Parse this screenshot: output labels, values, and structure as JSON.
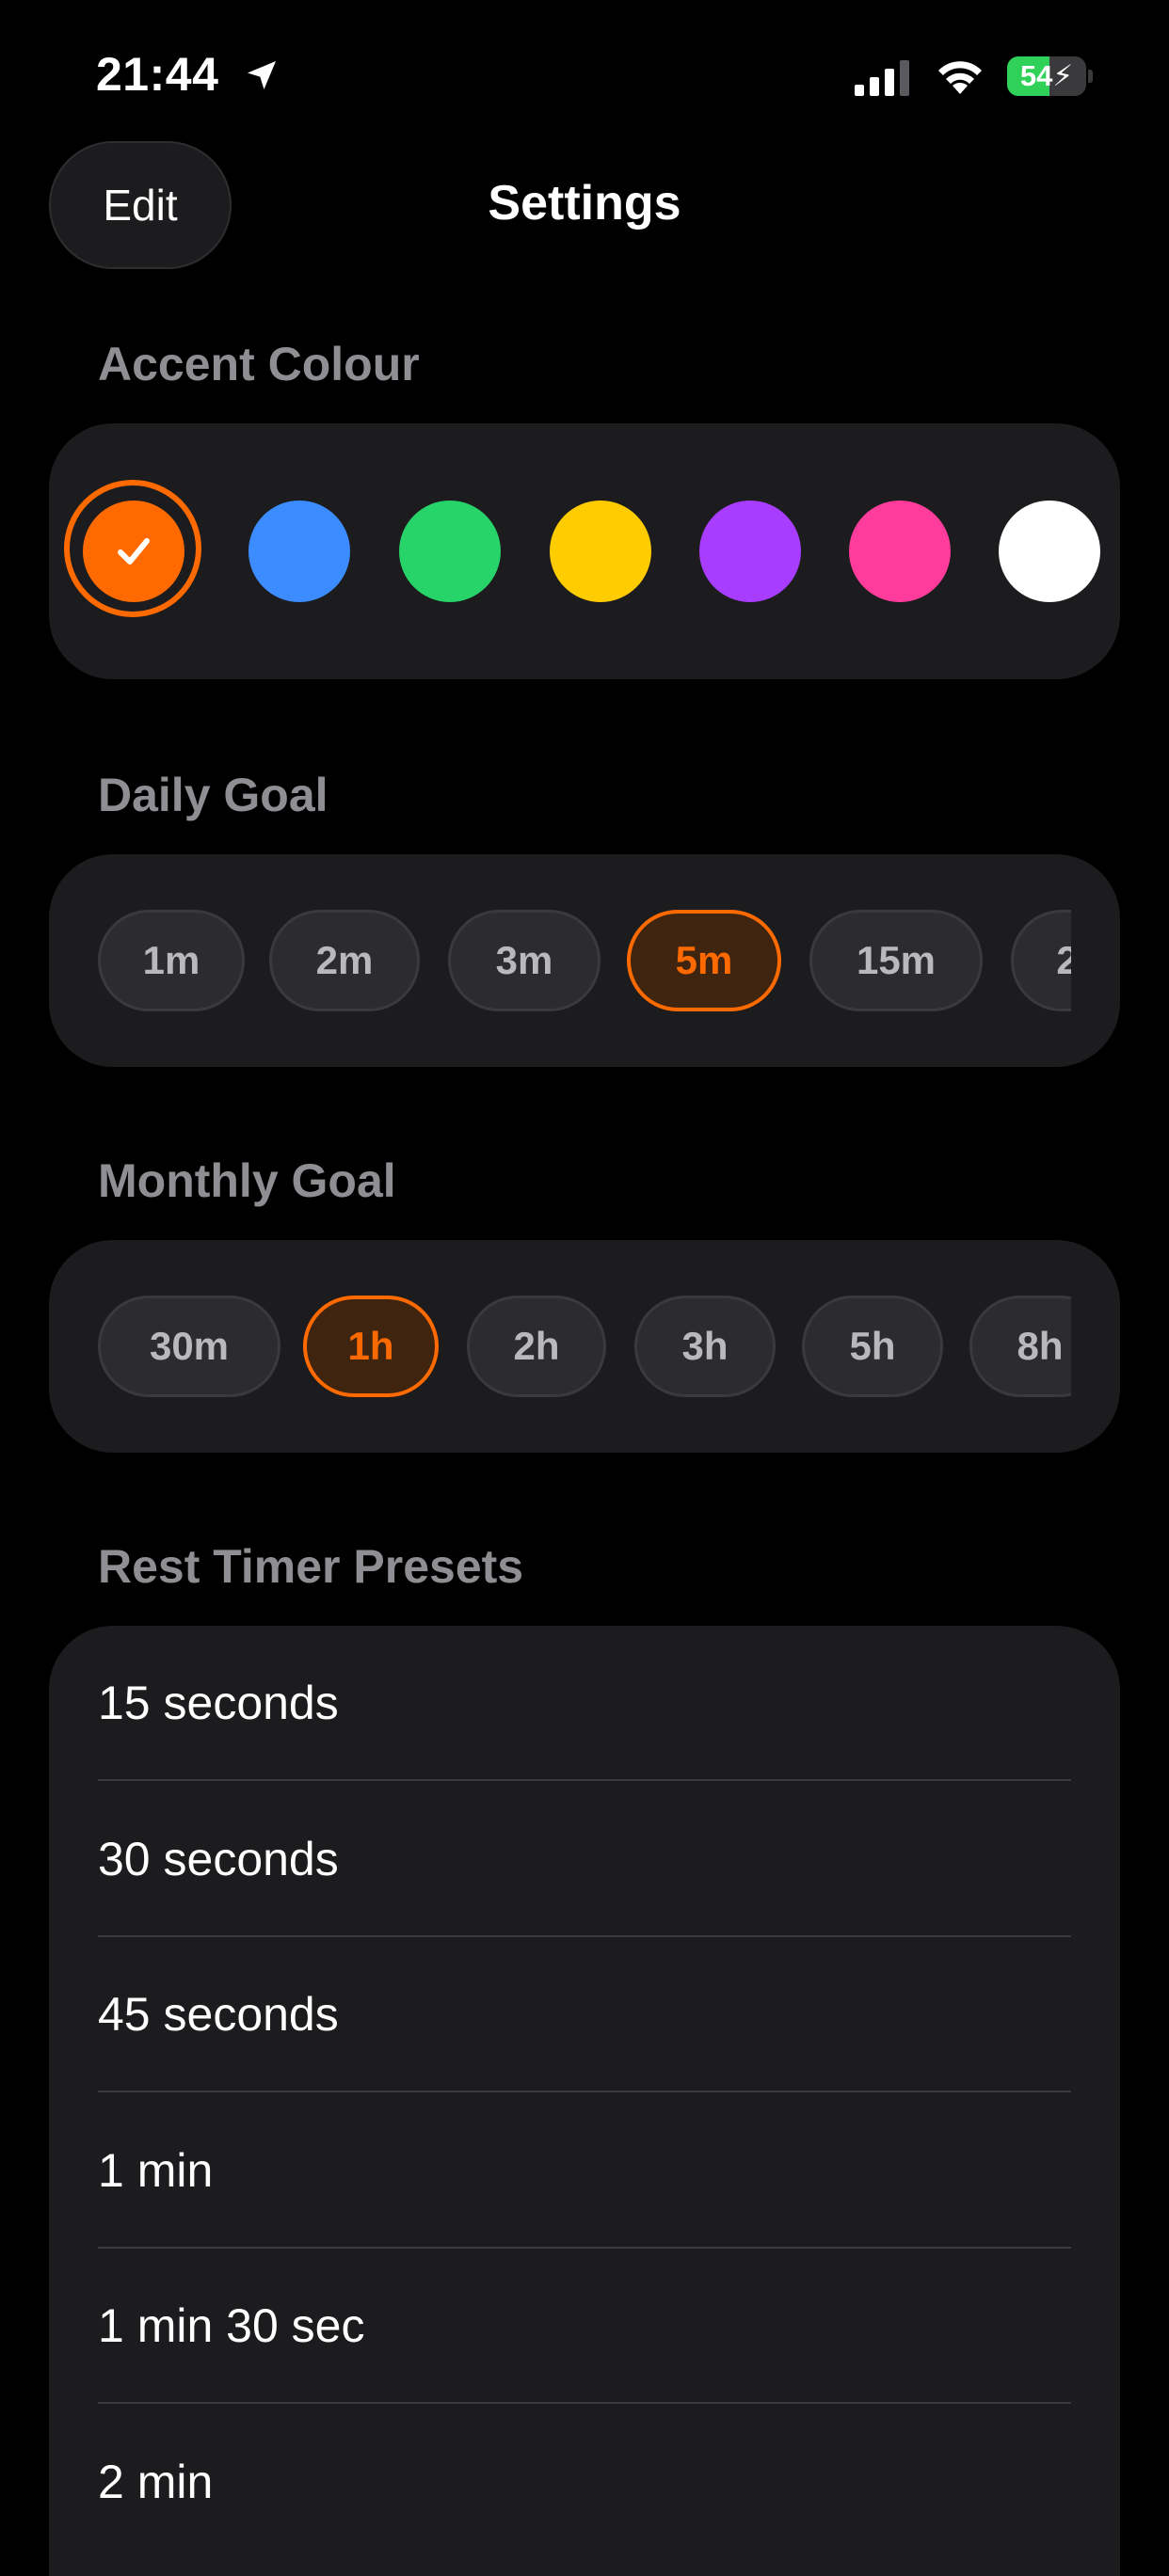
{
  "status_bar": {
    "time": "21:44",
    "battery_level": "54",
    "battery_fraction": 0.54,
    "icons": [
      "location-arrow-icon",
      "cellular-signal-icon",
      "wifi-icon",
      "battery-charging-icon"
    ]
  },
  "header": {
    "edit_label": "Edit",
    "title": "Settings"
  },
  "accent_colour": {
    "label": "Accent Colour",
    "selected": "orange",
    "swatches": [
      {
        "name": "orange",
        "color": "#ff6a00"
      },
      {
        "name": "blue",
        "color": "#3c8bff"
      },
      {
        "name": "green",
        "color": "#27d46a"
      },
      {
        "name": "yellow",
        "color": "#ffcc00"
      },
      {
        "name": "purple",
        "color": "#a83cff"
      },
      {
        "name": "pink",
        "color": "#ff3c9b"
      },
      {
        "name": "white",
        "color": "#ffffff"
      }
    ]
  },
  "daily_goal": {
    "label": "Daily Goal",
    "options": [
      "1m",
      "2m",
      "3m",
      "5m",
      "15m",
      "2"
    ],
    "selected": "5m"
  },
  "monthly_goal": {
    "label": "Monthly Goal",
    "options": [
      "30m",
      "1h",
      "2h",
      "3h",
      "5h",
      "8h"
    ],
    "selected": "1h"
  },
  "rest_timer": {
    "label": "Rest Timer Presets",
    "presets": [
      "15 seconds",
      "30 seconds",
      "45 seconds",
      "1 min",
      "1 min 30 sec",
      "2 min"
    ]
  },
  "colors": {
    "accent": "#ff6a00",
    "background": "#000000",
    "card": "#1c1c1e",
    "secondary_text": "#8e8e93",
    "battery_green": "#30d158"
  }
}
